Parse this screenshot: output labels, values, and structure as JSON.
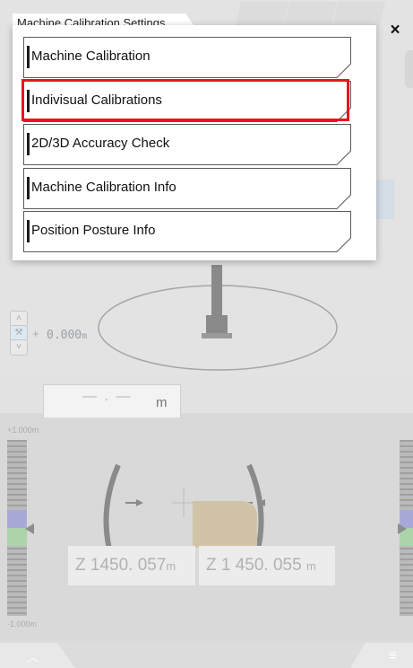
{
  "dialog": {
    "title": "Machine Calibration Settings",
    "close_label": "×",
    "items": [
      {
        "label": "Machine Calibration",
        "selected": false
      },
      {
        "label": "Indivisual Calibrations",
        "selected": true
      },
      {
        "label": "2D/3D Accuracy Check",
        "selected": false
      },
      {
        "label": "Machine Calibration Info",
        "selected": false
      },
      {
        "label": "Position Posture Info",
        "selected": false
      }
    ],
    "highlight_color": "#e8141b"
  },
  "background": {
    "offset_sign": "+",
    "offset_value": "0.000",
    "offset_unit": "m",
    "tab_value": "— . —",
    "tab_unit": "m",
    "scale_top": "+1.000m",
    "scale_bottom": "-1.000m",
    "z_left_value": "Z 1450. 057",
    "z_left_unit": "m",
    "z_right_value": "Z 1 450. 055",
    "z_right_unit": "m"
  },
  "icons": {
    "close": "close-icon",
    "up": "chevron-up-icon",
    "menu": "hamburger-menu-icon"
  }
}
